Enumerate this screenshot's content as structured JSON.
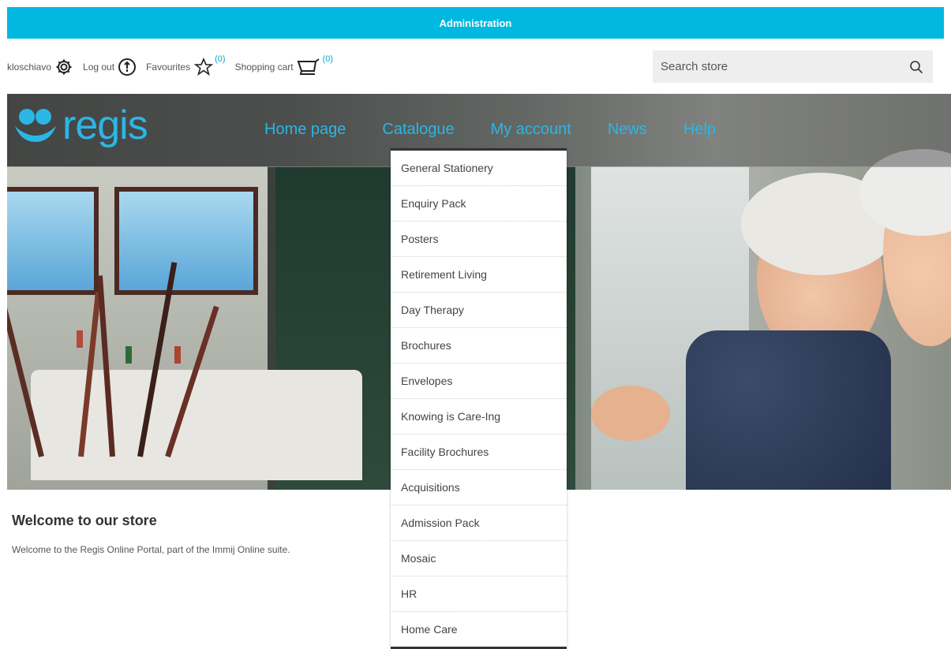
{
  "admin_bar": {
    "label": "Administration"
  },
  "header_links": {
    "username": "kloschiavo",
    "logout": "Log out",
    "favourites": "Favourites",
    "favourites_count": "(0)",
    "cart": "Shopping cart",
    "cart_count": "(0)"
  },
  "search": {
    "placeholder": "Search store"
  },
  "logo": {
    "text": "regis"
  },
  "nav": {
    "items": [
      "Home page",
      "Catalogue",
      "My account",
      "News",
      "Help"
    ]
  },
  "catalogue_menu": {
    "items": [
      "General Stationery",
      "Enquiry Pack",
      "Posters",
      "Retirement Living",
      "Day Therapy",
      "Brochures",
      "Envelopes",
      "Knowing is Care-Ing",
      "Facility Brochures",
      "Acquisitions",
      "Admission Pack",
      "Mosaic",
      "HR",
      "Home Care"
    ]
  },
  "welcome": {
    "title": "Welcome to our store",
    "text": "Welcome to the Regis Online Portal, part of the Immij Online suite."
  },
  "colors": {
    "accent": "#00b8e0",
    "brand": "#2bb6e6"
  }
}
